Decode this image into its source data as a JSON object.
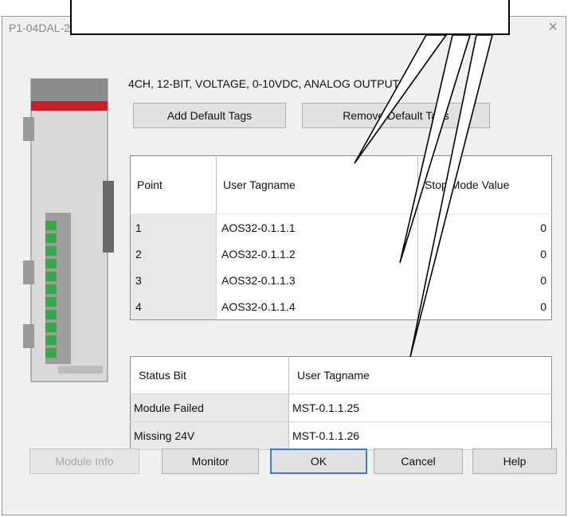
{
  "window": {
    "title": "P1-04DAL-2",
    "close_glyph": "×"
  },
  "module_description": "4CH, 12-BIT, VOLTAGE, 0-10VDC, ANALOG OUTPUT",
  "toolbar": {
    "add_default_tags": "Add Default Tags",
    "remove_default_tags": "Remove Default Tags"
  },
  "points_table": {
    "headers": [
      "Point",
      "User Tagname",
      "Stop Mode Value"
    ],
    "rows": [
      {
        "point": "1",
        "tag": "AOS32-0.1.1.1",
        "value": "0"
      },
      {
        "point": "2",
        "tag": "AOS32-0.1.1.2",
        "value": "0"
      },
      {
        "point": "3",
        "tag": "AOS32-0.1.1.3",
        "value": "0"
      },
      {
        "point": "4",
        "tag": "AOS32-0.1.1.4",
        "value": "0"
      }
    ]
  },
  "status_table": {
    "headers": [
      "Status Bit",
      "User Tagname"
    ],
    "rows": [
      {
        "bit": "Module Failed",
        "tag": "MST-0.1.1.25"
      },
      {
        "bit": "Missing 24V",
        "tag": "MST-0.1.1.26"
      }
    ]
  },
  "buttons": {
    "module_info": "Module Info",
    "monitor": "Monitor",
    "ok": "OK",
    "cancel": "Cancel",
    "help": "Help"
  },
  "colors": {
    "module_red": "#c8202a",
    "terminal_green": "#3aa64a",
    "accent_blue": "#3a7bd5"
  },
  "icons": {
    "close": "close-icon",
    "module": "plc-module-icon"
  }
}
